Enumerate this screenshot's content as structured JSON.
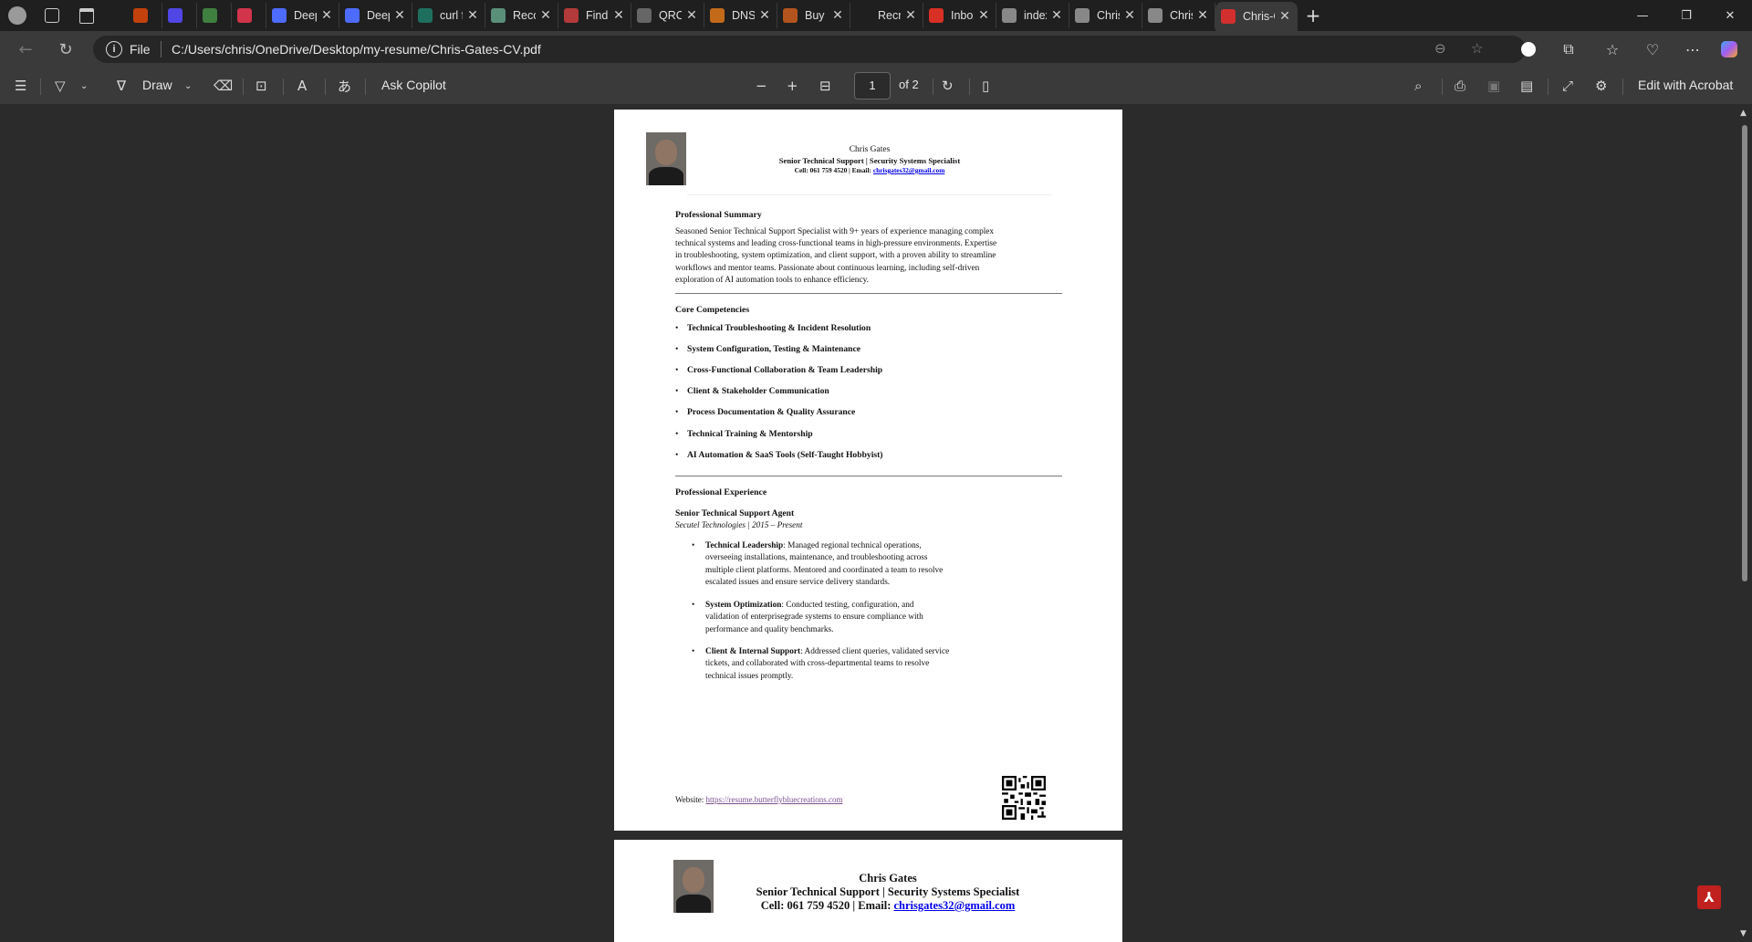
{
  "browser": {
    "tabs": [
      {
        "title": "",
        "color": "#c2410c",
        "icon": "copilot-icon"
      },
      {
        "title": "",
        "color": "#4f46e5",
        "icon": "meet-icon"
      },
      {
        "title": "",
        "color": "#3f7f3f",
        "icon": "p-icon"
      },
      {
        "title": "",
        "color": "#d1344b",
        "icon": "git-icon"
      },
      {
        "title": "DeepSe",
        "color": "#4d6bfe",
        "icon": "deepseek-icon"
      },
      {
        "title": "DeepSe",
        "color": "#4d6bfe",
        "icon": "deepseek-icon"
      },
      {
        "title": "curl for",
        "color": "#1f6f5f",
        "icon": "curl-icon"
      },
      {
        "title": "Recom",
        "color": "#5a8f7a",
        "icon": "recom-icon"
      },
      {
        "title": "Find en",
        "color": "#b33a3a",
        "icon": "find-icon"
      },
      {
        "title": "QRCod",
        "color": "#666666",
        "icon": "qrcode-icon"
      },
      {
        "title": "DNS | F",
        "color": "#c26a1a",
        "icon": "cloud-icon"
      },
      {
        "title": "Buy a c",
        "color": "#b3541e",
        "icon": "buy-icon"
      },
      {
        "title": "Recruit",
        "color": "#1f1f1f",
        "icon": "recruit-icon"
      },
      {
        "title": "Inbox (",
        "color": "#d93025",
        "icon": "gmail-icon"
      },
      {
        "title": "index.h",
        "color": "#888888",
        "icon": "globe-icon"
      },
      {
        "title": "Chris G",
        "color": "#888888",
        "icon": "globe-icon"
      },
      {
        "title": "Chris G",
        "color": "#888888",
        "icon": "globe-icon"
      },
      {
        "title": "Chris-G",
        "color": "#d32f2f",
        "icon": "pdf-icon",
        "active": true
      }
    ],
    "new_tab": "+",
    "scheme": "File",
    "url": "C:/Users/chris/OneDrive/Desktop/my-resume/Chris-Gates-CV.pdf"
  },
  "pdf_toolbar": {
    "draw_label": "Draw",
    "ask_copilot_label": "Ask Copilot",
    "page_current": "1",
    "page_of": "of 2",
    "edit_acrobat_label": "Edit with Acrobat"
  },
  "resume": {
    "name": "Chris Gates",
    "title": "Senior Technical Support | Security Systems Specialist",
    "contact_prefix": "Cell: 061 759 4520 | Email:",
    "email": "chrisgates32@gmail.com",
    "summary_heading": "Professional Summary",
    "summary_lines": [
      "Seasoned Senior Technical Support Specialist with 9+ years of experience managing complex",
      "technical systems and leading cross-functional teams in high-pressure environments. Expertise",
      "in troubleshooting, system optimization, and client support, with a proven ability to streamline",
      "workflows and mentor teams. Passionate about continuous learning, including self-driven",
      "exploration of AI automation tools to enhance efficiency."
    ],
    "competencies_heading": "Core Competencies",
    "competencies": [
      "Technical Troubleshooting & Incident Resolution",
      "System Configuration, Testing & Maintenance",
      "Cross-Functional Collaboration & Team Leadership",
      "Client & Stakeholder Communication",
      "Process Documentation & Quality Assurance",
      "Technical Training & Mentorship",
      "AI Automation & SaaS Tools (Self-Taught Hobbyist)"
    ],
    "experience_heading": "Professional Experience",
    "job_title": "Senior Technical Support Agent",
    "job_company": "Secutel Technologies | 2015 – Present",
    "job_bullets": [
      {
        "label": "Technical Leadership",
        "lines": [
          ": Managed regional technical operations,",
          "overseeing installations, maintenance, and troubleshooting across",
          "multiple client platforms. Mentored and coordinated a team to resolve",
          "escalated issues and ensure service delivery standards."
        ]
      },
      {
        "label": "System Optimization",
        "lines": [
          ": Conducted testing, configuration, and",
          "validation of enterprisegrade systems to ensure compliance with",
          "performance and quality benchmarks."
        ]
      },
      {
        "label": "Client & Internal Support",
        "lines": [
          ": Addressed client queries, validated service",
          "tickets, and collaborated with cross-departmental teams to resolve",
          "technical issues promptly."
        ]
      }
    ],
    "website_label": "Website:",
    "website_url": "https://resume.butterflybluecreations.com",
    "page2": {
      "name": "Chris Gates",
      "title": "Senior Technical Support | Security Systems Specialist",
      "contact_prefix": "Cell: 061 759 4520 | Email:",
      "email": "chrisgates32@gmail.com"
    }
  }
}
